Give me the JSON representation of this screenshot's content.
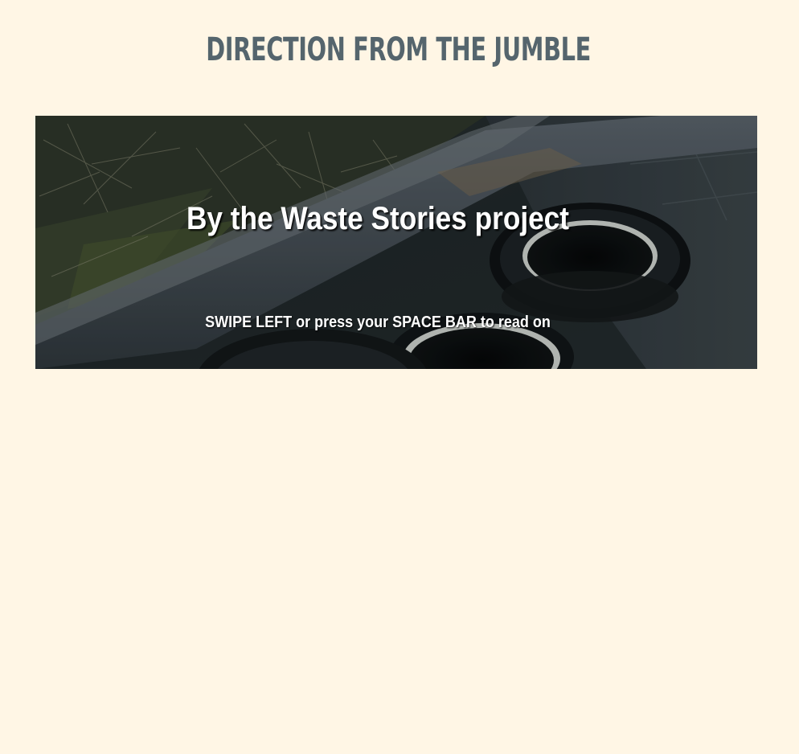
{
  "page": {
    "title": "DIRECTION FROM THE JUMBLE"
  },
  "slide": {
    "heading": "By the Waste Stories project",
    "hint": "SWIPE LEFT or press your SPACE BAR to read on",
    "image_subject": "discarded tyres beside a stone curb and dry grass"
  },
  "colors": {
    "background": "#fff6e5",
    "title": "#55656d",
    "overlay_text": "#ffffff"
  }
}
